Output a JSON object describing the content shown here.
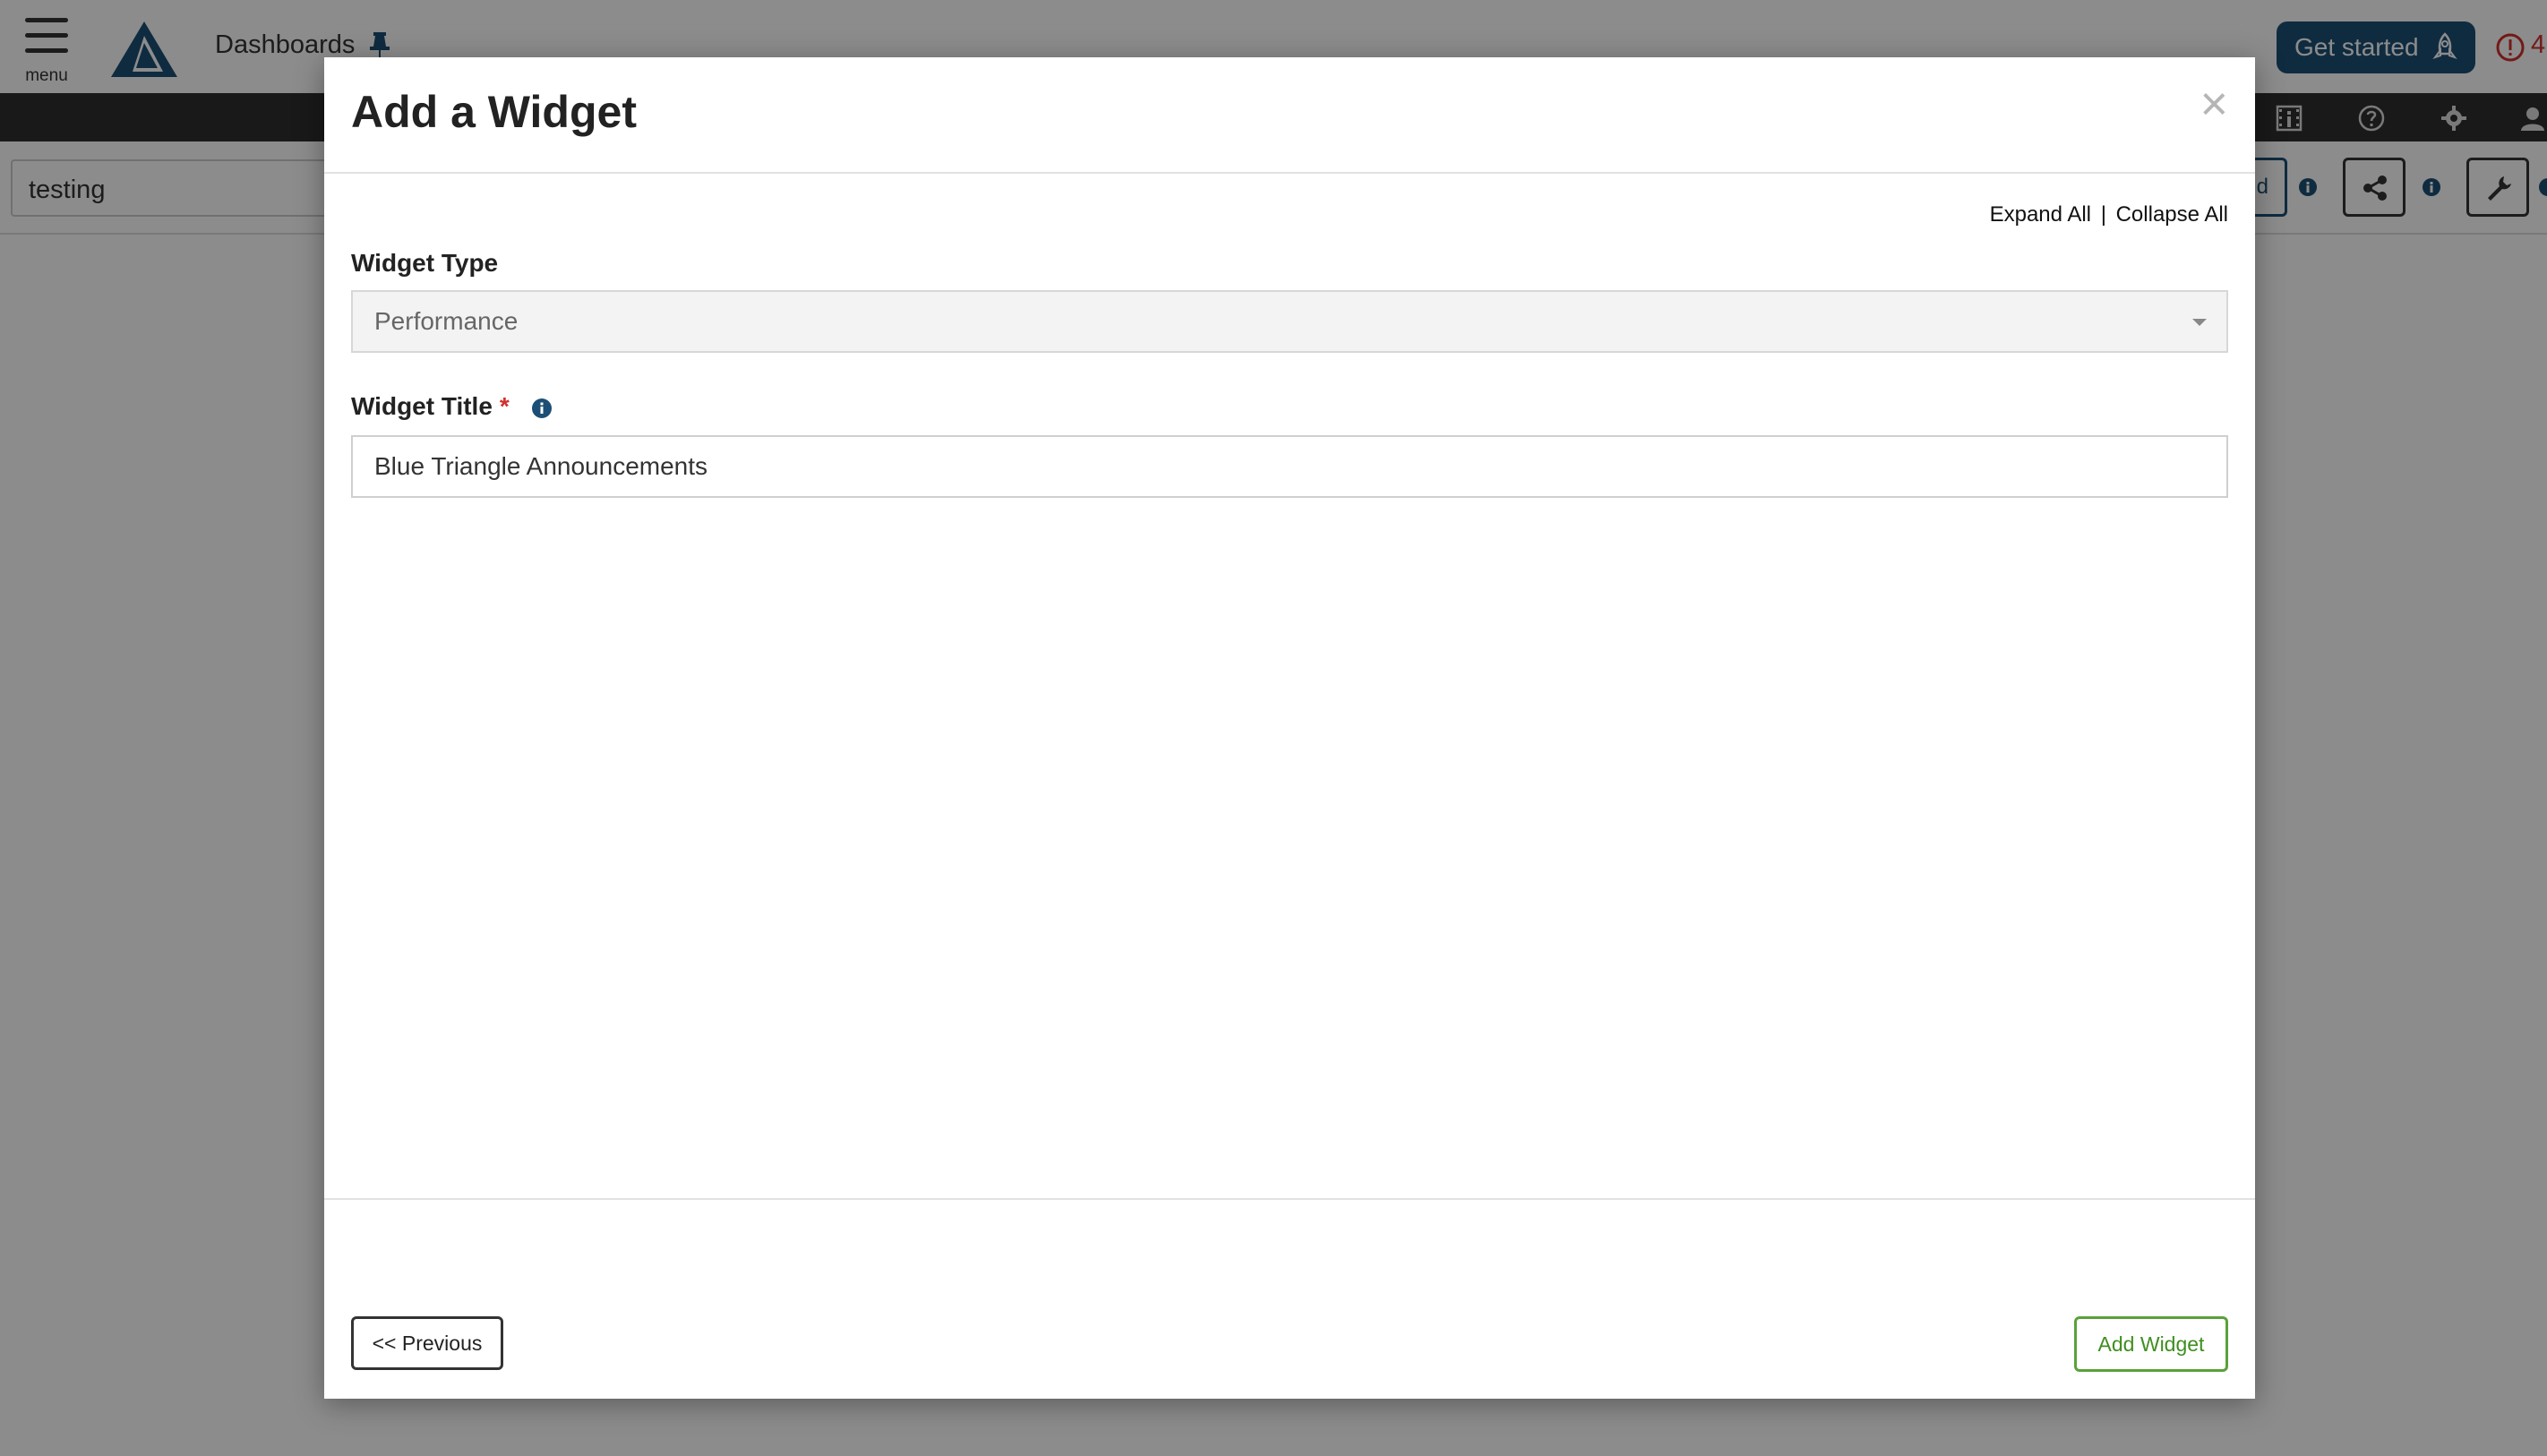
{
  "header": {
    "menu_label": "menu",
    "breadcrumb": "Dashboards",
    "get_started_label": "Get started",
    "alert_count": "4"
  },
  "toolbar": {
    "dashboard_name": "testing",
    "partial_button_text": "d"
  },
  "modal": {
    "title": "Add a Widget",
    "close_symbol": "×",
    "expand_all": "Expand All",
    "separator": "|",
    "collapse_all": "Collapse All",
    "widget_type_label": "Widget Type",
    "widget_type_value": "Performance",
    "widget_title_label": "Widget Title",
    "required_marker": "*",
    "widget_title_value": "Blue Triangle Announcements",
    "previous_label": "<< Previous",
    "add_widget_label": "Add Widget"
  },
  "colors": {
    "brand_navy": "#1d4f76",
    "alert_red": "#d0312d",
    "add_green": "#3f8e1f",
    "dark_bar": "#2e2e2e"
  },
  "icons": [
    "menu-icon",
    "logo",
    "pin-icon",
    "rocket-icon",
    "alert-icon",
    "film-icon",
    "help-icon",
    "gear-icon",
    "user-icon",
    "share-icon",
    "wrench-icon",
    "info-icon",
    "close-icon",
    "caret-down-icon"
  ]
}
